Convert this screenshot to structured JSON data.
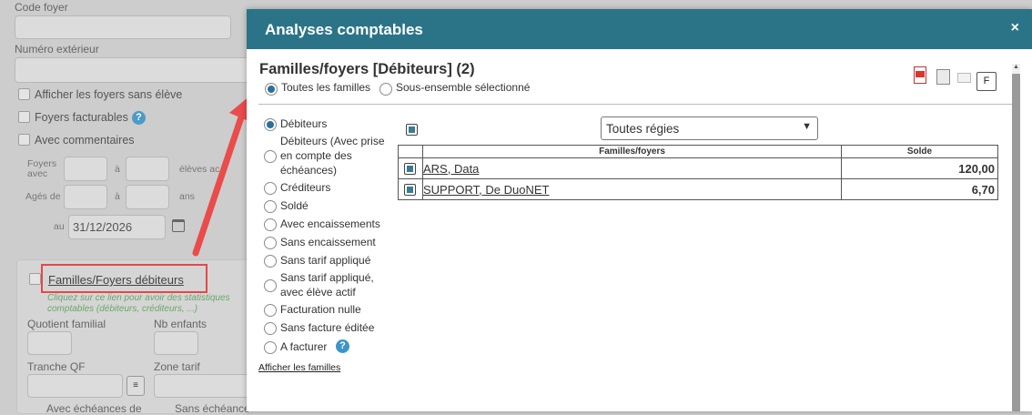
{
  "background_form": {
    "code_foyer_label": "Code foyer",
    "numero_exterieur_label": "Numéro extérieur",
    "checkboxes": [
      "Afficher les foyers sans élève",
      "Foyers facturables",
      "Avec commentaires"
    ],
    "foyers_avec_label": "Foyers avec",
    "a_label": "à",
    "eleves_label": "élèves ac",
    "ages_de_label": "Agés de",
    "ans_label": "ans",
    "au_label": "au",
    "date_value": "31/12/2026",
    "link_label": "Familles/Foyers débiteurs",
    "hint_text": "Cliquez sur ce lien pour avoir des statistiques comptables (débiteurs, créditeurs, ...)",
    "quotient_label": "Quotient familial",
    "nb_enfants_label": "Nb enfants",
    "tranche_label": "Tranche QF",
    "zone_tarif_label": "Zone tarif",
    "avec_echeances_label": "Avec échéances de",
    "sans_echeance_label": "Sans échéance"
  },
  "modal": {
    "title": "Analyses comptables",
    "close_label": "×",
    "section_title": "Familles/foyers [Débiteurs] (2)",
    "scope_options": [
      "Toutes les familles",
      "Sous-ensemble sélectionné"
    ],
    "f_button": "F",
    "filters": [
      "Débiteurs",
      "Débiteurs (Avec prise en compte des échéances)",
      "Créditeurs",
      "Soldé",
      "Avec encaissements",
      "Sans encaissement",
      "Sans tarif appliqué",
      "Sans tarif appliqué, avec élève actif",
      "Facturation nulle",
      "Sans facture éditée",
      "A facturer"
    ],
    "afficher_label": "Afficher les familles",
    "regie_select": "Toutes régies",
    "table": {
      "headers": [
        "Familles/foyers",
        "Solde"
      ],
      "rows": [
        {
          "name": "ARS, Data",
          "solde": "120,00"
        },
        {
          "name": "SUPPORT, De DuoNET",
          "solde": "6,70"
        }
      ]
    },
    "help_icon": "?"
  }
}
